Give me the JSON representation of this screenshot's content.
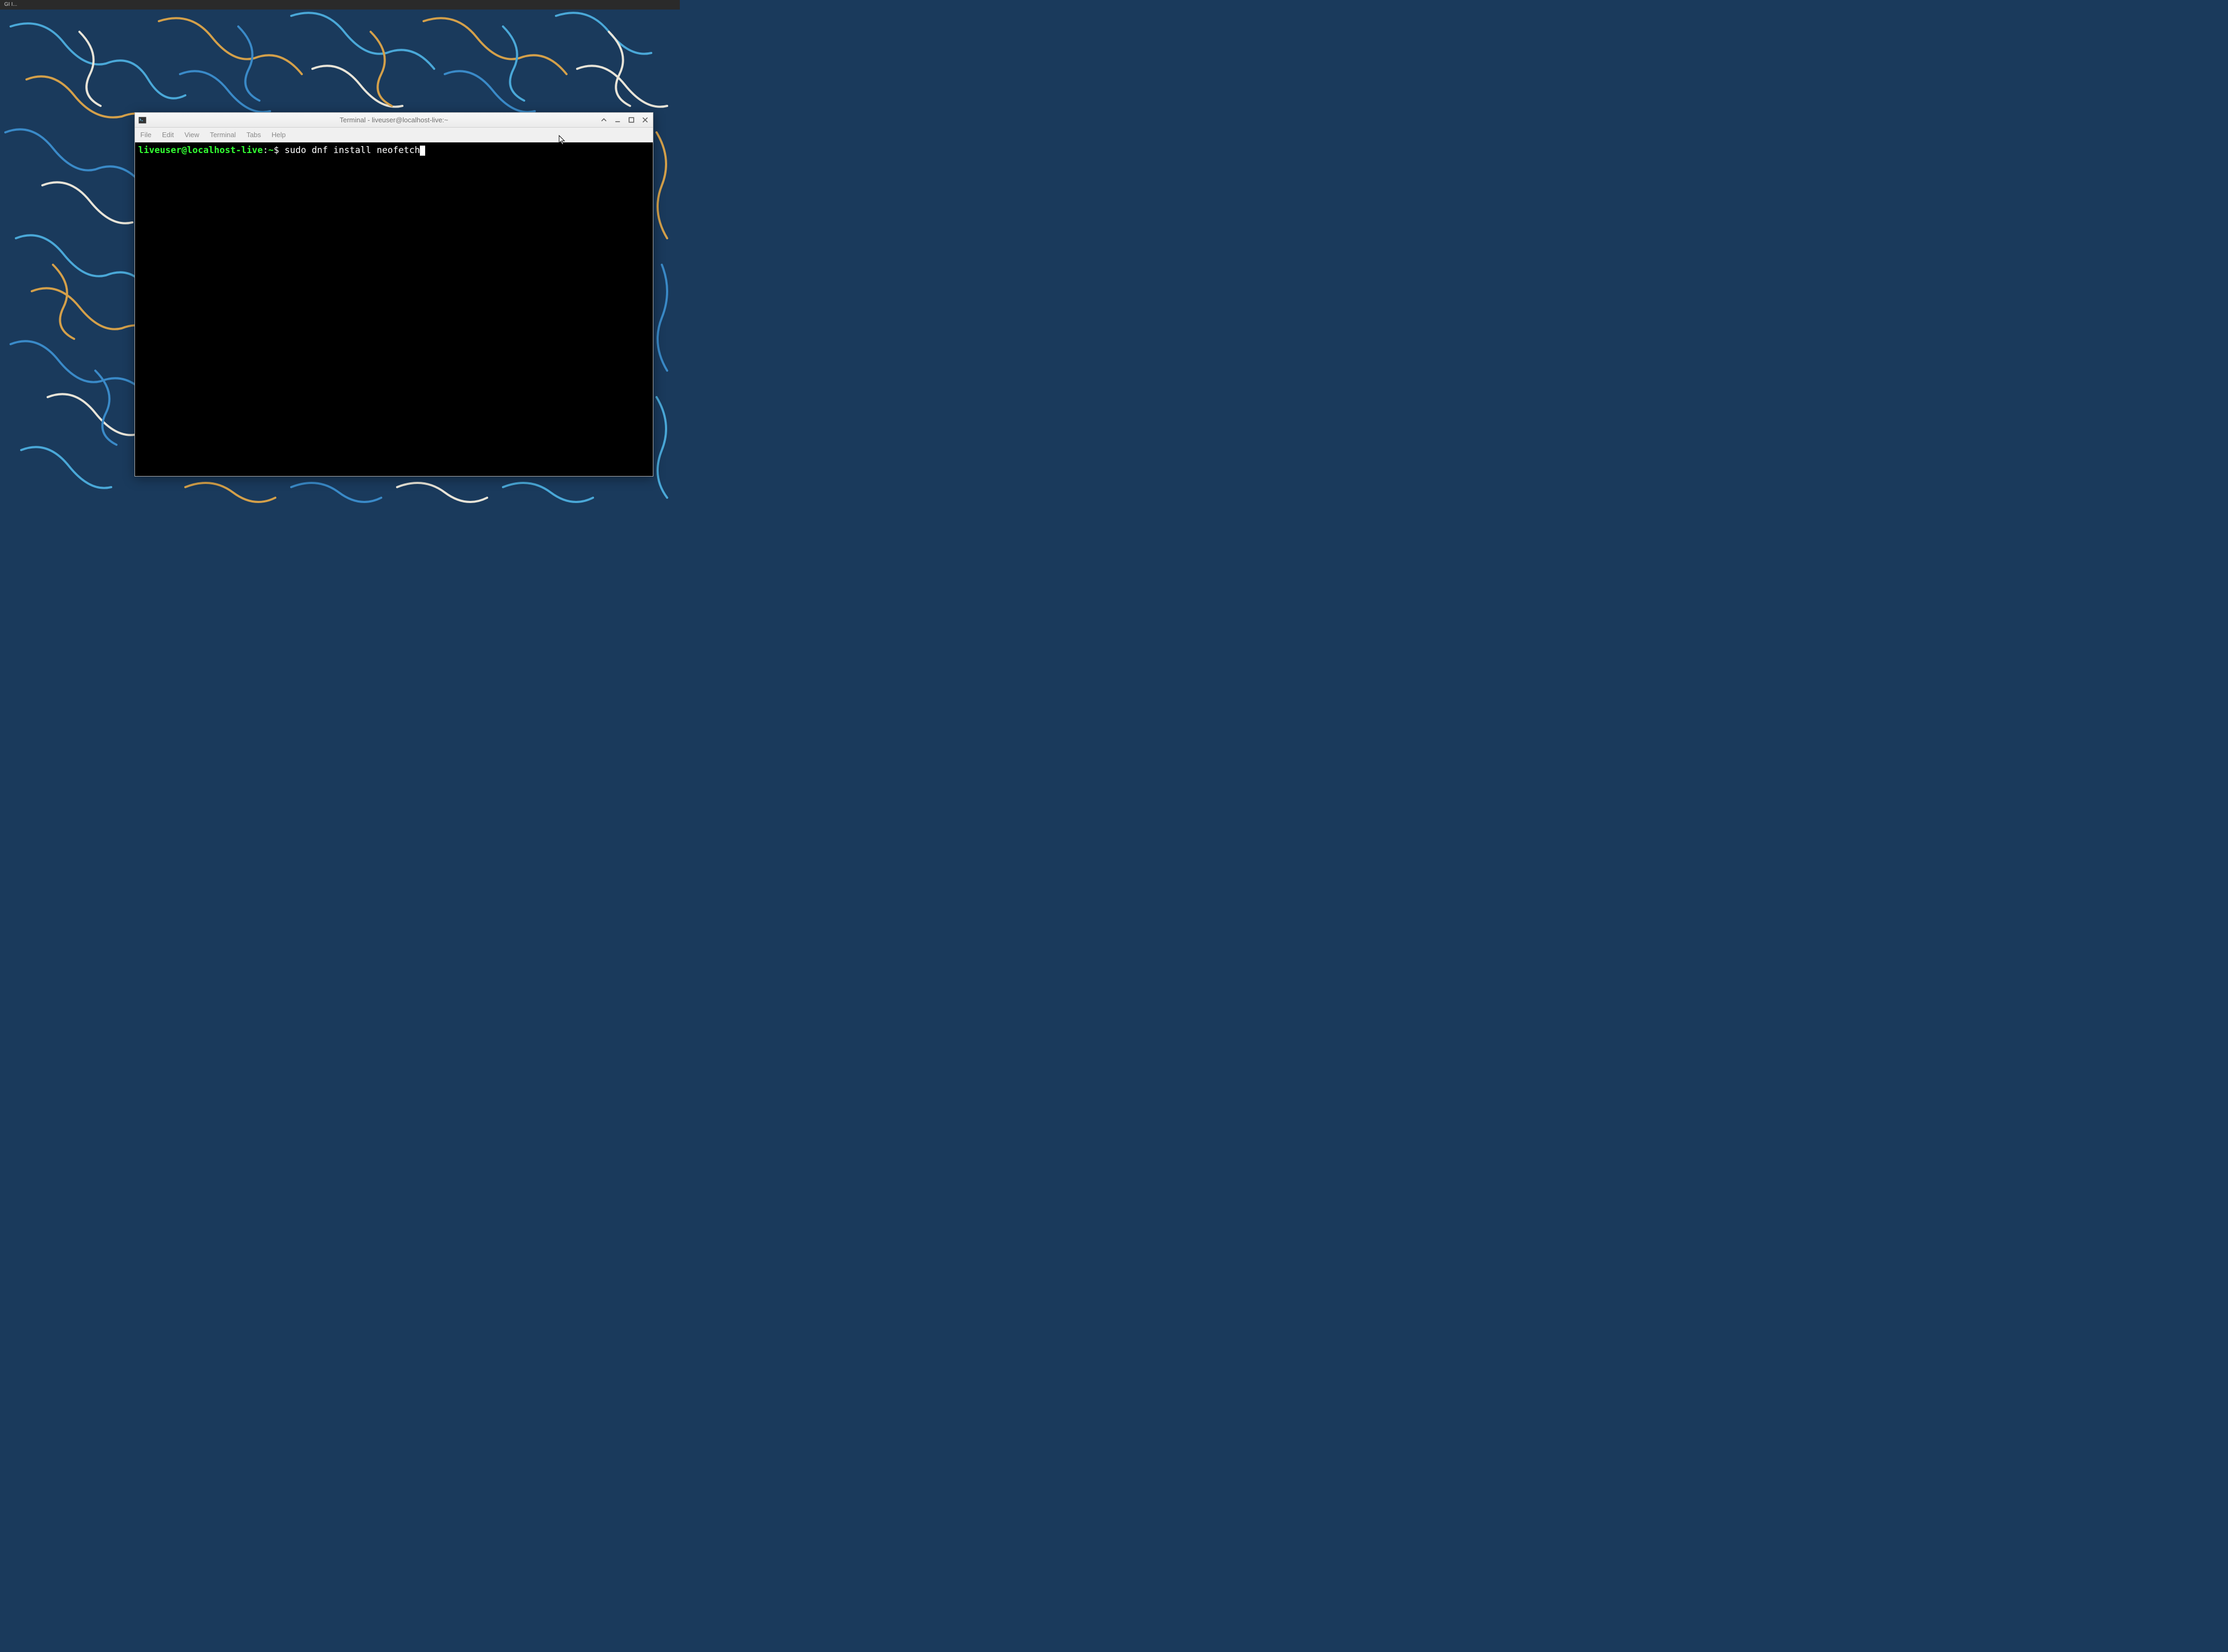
{
  "taskbar": {
    "item_label": "GI I..."
  },
  "window": {
    "title": "Terminal - liveuser@localhost-live:~"
  },
  "menu": {
    "file": "File",
    "edit": "Edit",
    "view": "View",
    "terminal": "Terminal",
    "tabs": "Tabs",
    "help": "Help"
  },
  "terminal": {
    "prompt_user": "liveuser@localhost-live",
    "prompt_separator": ":",
    "prompt_path": "~",
    "prompt_symbol": "$",
    "command": " sudo dnf install neofetch"
  }
}
